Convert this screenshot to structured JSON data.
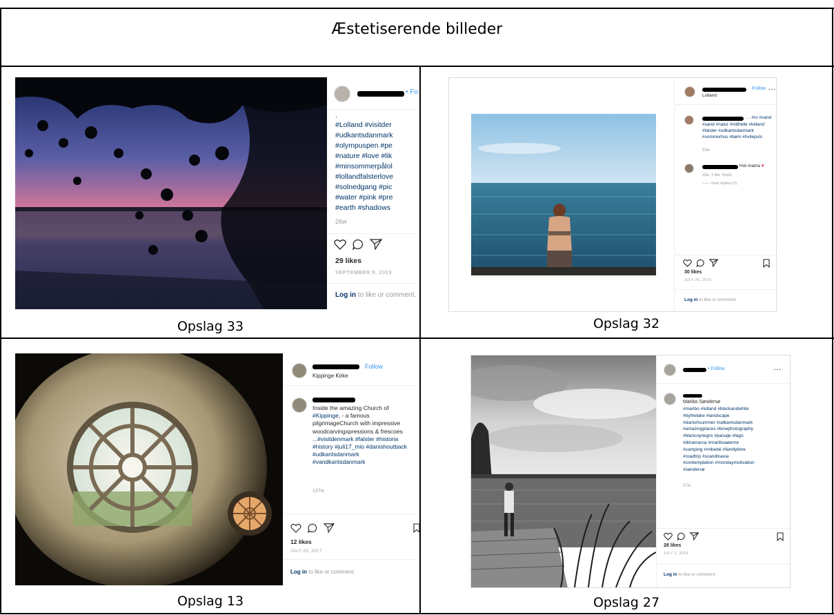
{
  "title": "Æstetiserende billeder",
  "captions": [
    "Opslag 33",
    "Opslag 32",
    "Opslag 13",
    "Opslag 27"
  ],
  "colors": {
    "link": "#003569",
    "follow": "#3897f0",
    "muted": "#999999",
    "border": "#000000"
  },
  "posts": [
    {
      "follow": "• Fo",
      "dot": ".",
      "hashtags": "#Lolland #visitder\n#udkantsdanmark\n#olympuspen #pe\n#nature #love #lik\n#minsommerpålol\n#lollandfalsterlove\n#solnedgang #pic\n#water #pink #pre\n#earth #shadows",
      "age": "26w",
      "likes": "29 likes",
      "date": "SEPTEMBER 9, 2019",
      "login_link": "Log in",
      "login_text": " to like or comment."
    },
    {
      "follow": "Follow",
      "location": "Lolland",
      "more": "···",
      "caption_tail": ". . #ro #vand",
      "hashtags": "#sand #natur #mithelle #lolland\n#falster #udkantsdanmark\n#sommerhus #børn #hvilepuls",
      "age": "33w",
      "comment_text": "Hot mama",
      "comment_meta": "33w  1 like  Reply",
      "view_replies": "View replies (1)",
      "likes": "30 likes",
      "date": "JULY 26, 2019",
      "login_link": "Log in",
      "login_text": " to like or comment."
    },
    {
      "follow": "Follow",
      "location": "Kippinge Kirke",
      "caption_plain": "Inside the amazing Church of",
      "hashtags_a": "#Kippinge",
      "caption_plain2": ", - a famous\npilgrimageChurch with impressive\nwoodcarvingxpressions & frescoes\n...",
      "hashtags": "#visitdenmark #falster #historia\n#history #juli17_mio #danishoutback\n#udkantsdanmark\n#vandkantsdanmark",
      "age": "137w",
      "likes": "12 likes",
      "date": "JULY 28, 2017",
      "login_link": "Log in",
      "login_text": " to like or comment."
    },
    {
      "follow": "Follow",
      "more": "···",
      "location": "Maribo Søndersø",
      "hashtags": "#maribo #lolland #blackandwhite\n#bythelake #landscape\n#danishsummer #udkantsdanmark\n#amazingplaces #bnwphotography\n#blancoynegro #paisaje #lago\n#dinamarca #mariboaøerne\n#camping #mibebé #familytime\n#roadtrip #scandinavia\n#contemplation #mondaymotivation\n#søndersø",
      "age": "37w",
      "likes": "28 likes",
      "date": "JULY 1, 2019",
      "login_link": "Log in",
      "login_text": " to like or comment."
    }
  ]
}
